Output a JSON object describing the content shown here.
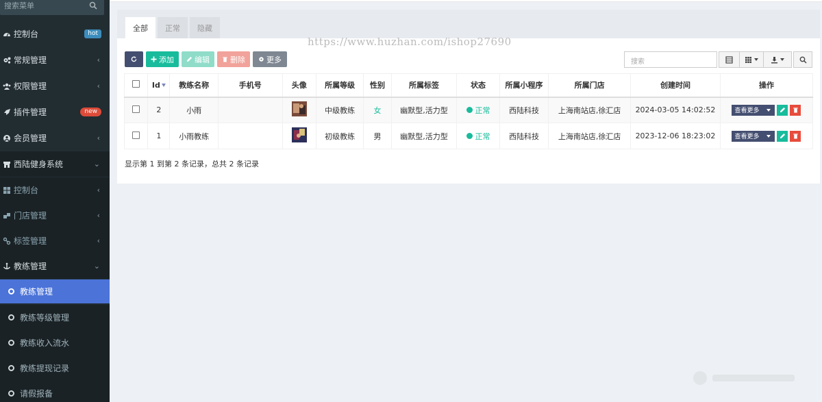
{
  "sidebar": {
    "search_placeholder": "搜索菜单",
    "items": [
      {
        "label": "控制台",
        "icon": "dashboard-icon",
        "badge": "hot"
      },
      {
        "label": "常规管理",
        "icon": "cogs-icon"
      },
      {
        "label": "权限管理",
        "icon": "group-icon"
      },
      {
        "label": "插件管理",
        "icon": "rocket-icon",
        "badge": "new"
      },
      {
        "label": "会员管理",
        "icon": "user-circle-icon"
      },
      {
        "label": "西陆健身系统",
        "icon": "store-icon"
      },
      {
        "label": "控制台",
        "icon": "windows-icon"
      },
      {
        "label": "门店管理",
        "icon": "cubes-icon"
      },
      {
        "label": "标签管理",
        "icon": "link-icon"
      },
      {
        "label": "教练管理",
        "icon": "anchor-icon"
      },
      {
        "label": "教练管理",
        "active": true
      },
      {
        "label": "教练等级管理"
      },
      {
        "label": "教练收入流水"
      },
      {
        "label": "教练提现记录"
      },
      {
        "label": "请假报备"
      }
    ]
  },
  "tabs": [
    "全部",
    "正常",
    "隐藏"
  ],
  "toolbar": {
    "refresh": "",
    "add": "添加",
    "edit": "编辑",
    "delete": "删除",
    "more": "更多",
    "search_placeholder": "搜索"
  },
  "watermark": "https://www.huzhan.com/ishop27690",
  "table": {
    "headers": [
      "Id",
      "教练名称",
      "手机号",
      "头像",
      "所属等级",
      "性别",
      "所属标签",
      "状态",
      "所属小程序",
      "所属门店",
      "创建时间",
      "操作"
    ],
    "rows": [
      {
        "id": "2",
        "name": "小雨",
        "phone": "",
        "level": "中级教练",
        "gender": "女",
        "tags": "幽默型,活力型",
        "status": "正常",
        "app": "西陆科技",
        "store": "上海南站店,徐汇店",
        "created": "2024-03-05 14:02:52",
        "more": "查看更多"
      },
      {
        "id": "1",
        "name": "小雨教练",
        "phone": "",
        "level": "初级教练",
        "gender": "男",
        "tags": "幽默型,活力型",
        "status": "正常",
        "app": "西陆科技",
        "store": "上海南站店,徐汇店",
        "created": "2023-12-06 18:23:02",
        "more": "查看更多"
      }
    ]
  },
  "summary": "显示第 1 到第 2 条记录，总共 2 条记录",
  "colors": {
    "sidebar_bg": "#222d32",
    "active": "#4b73d8",
    "success": "#18bc9c",
    "danger": "#e74c3c",
    "primary_dark": "#444e70"
  }
}
